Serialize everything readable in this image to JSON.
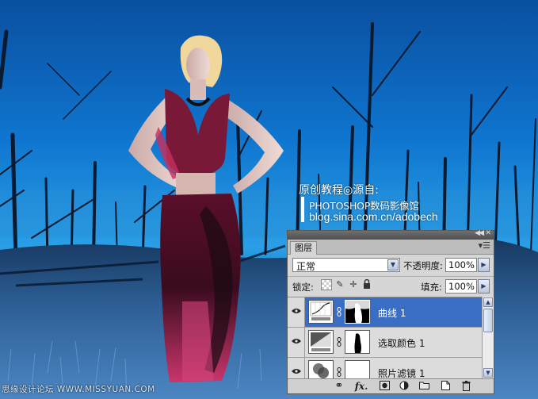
{
  "credits": {
    "line1": "原创教程◎源自:",
    "line2": "PHOTOSHOP数码影像馆",
    "line3": "blog.sina.com.cn/adobech"
  },
  "bottom_watermark": "思缘设计论坛 WWW.MISSYUAN.COM",
  "layers_panel": {
    "tab_label": "图层",
    "blend_mode": "正常",
    "opacity_label": "不透明度:",
    "opacity_value": "100%",
    "lock_label": "锁定:",
    "fill_label": "填充:",
    "fill_value": "100%",
    "layers": [
      {
        "name": "曲线 1",
        "type": "curves",
        "selected": true,
        "visible": true
      },
      {
        "name": "选取颜色 1",
        "type": "selective-color",
        "selected": false,
        "visible": true
      },
      {
        "name": "照片滤镜 1",
        "type": "photo-filter",
        "selected": false,
        "visible": true
      }
    ],
    "colors": {
      "selection": "#3a6ec4",
      "panel_bg": "#d6d6d6"
    }
  }
}
